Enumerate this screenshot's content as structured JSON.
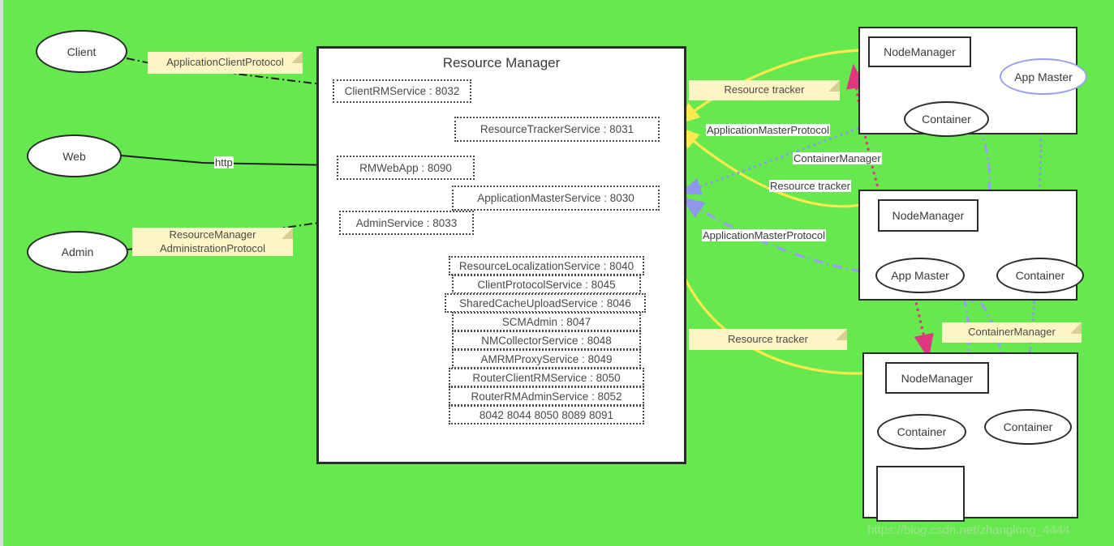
{
  "page": {
    "title": "Hadoop YARN Resource Manager architecture diagram",
    "background_color": "#66e84f",
    "watermark": "https://blog.csdn.net/zhanglong_4444"
  },
  "colors": {
    "background": "#66e84f",
    "note_fill": "#fdf5c4",
    "note_fold": "#d9cf92",
    "box_border": "#2b2b2b",
    "service_border": "#4a4a4a",
    "yellow_edge": "#ffe94d",
    "pink_edge": "#e0357f",
    "green_edge": "#3f7d23",
    "lavender_edge": "#9a9ef0",
    "periwinkle_edge": "#8f96ee",
    "black_edge": "#1f1f1f"
  },
  "actors": [
    {
      "id": "client",
      "label": "Client"
    },
    {
      "id": "web",
      "label": "Web"
    },
    {
      "id": "admin",
      "label": "Admin"
    }
  ],
  "resource_manager": {
    "title": "Resource Manager",
    "entry_services": [
      {
        "id": "clientrm",
        "label": "ClientRMService : 8032"
      },
      {
        "id": "rtservice",
        "label": "ResourceTrackerService : 8031"
      },
      {
        "id": "rmwebapp",
        "label": "RMWebApp : 8090"
      },
      {
        "id": "amservice",
        "label": "ApplicationMasterService : 8030"
      },
      {
        "id": "adminsvc",
        "label": "AdminService : 8033"
      }
    ],
    "other_services": [
      {
        "id": "svc-8040",
        "label": "ResourceLocalizationService : 8040"
      },
      {
        "id": "svc-8045",
        "label": "ClientProtocolService :  8045"
      },
      {
        "id": "svc-8046",
        "label": "SharedCacheUploadService :  8046"
      },
      {
        "id": "svc-8047",
        "label": "SCMAdmin :  8047"
      },
      {
        "id": "svc-8048",
        "label": "NMCollectorService : 8048"
      },
      {
        "id": "svc-8049",
        "label": "AMRMProxyService :  8049"
      },
      {
        "id": "svc-8050",
        "label": "RouterClientRMService :  8050"
      },
      {
        "id": "svc-8052",
        "label": "RouterRMAdminService :  8052"
      },
      {
        "id": "svc-ports",
        "label": "8042 8044  8050 8089 8091"
      }
    ]
  },
  "clusters": [
    {
      "id": "cluster-top",
      "nodemanager": "NodeManager",
      "nodes": [
        {
          "id": "top-container",
          "label": "Container",
          "style": "dark"
        },
        {
          "id": "top-appmaster",
          "label": "App Master",
          "style": "lavender"
        }
      ],
      "blank_box": false
    },
    {
      "id": "cluster-middle",
      "nodemanager": "NodeManager",
      "nodes": [
        {
          "id": "mid-appmaster",
          "label": "App Master",
          "style": "dark"
        },
        {
          "id": "mid-container",
          "label": "Container",
          "style": "dark"
        }
      ],
      "blank_box": false
    },
    {
      "id": "cluster-bottom",
      "nodemanager": "NodeManager",
      "nodes": [
        {
          "id": "bot-container-1",
          "label": "Container",
          "style": "dark"
        },
        {
          "id": "bot-container-2",
          "label": "Container",
          "style": "dark"
        }
      ],
      "blank_box": true
    }
  ],
  "notes": [
    {
      "id": "note-acp",
      "lines": [
        "ApplicationClientProtocol"
      ]
    },
    {
      "id": "note-rmap",
      "lines": [
        "ResourceManager",
        "AdministrationProtocol"
      ]
    },
    {
      "id": "note-rt-top",
      "lines": [
        "Resource tracker"
      ]
    },
    {
      "id": "note-rt-bottom",
      "lines": [
        "Resource tracker"
      ]
    },
    {
      "id": "note-cm-bottom",
      "lines": [
        "ContainerManager"
      ]
    }
  ],
  "edge_labels": [
    {
      "id": "label-http",
      "text": "http"
    },
    {
      "id": "label-amp-1",
      "text": "ApplicationMasterProtocol"
    },
    {
      "id": "label-cm-1",
      "text": "ContainerManager"
    },
    {
      "id": "label-rt-1",
      "text": "Resource tracker"
    },
    {
      "id": "label-amp-2",
      "text": "ApplicationMasterProtocol"
    }
  ]
}
